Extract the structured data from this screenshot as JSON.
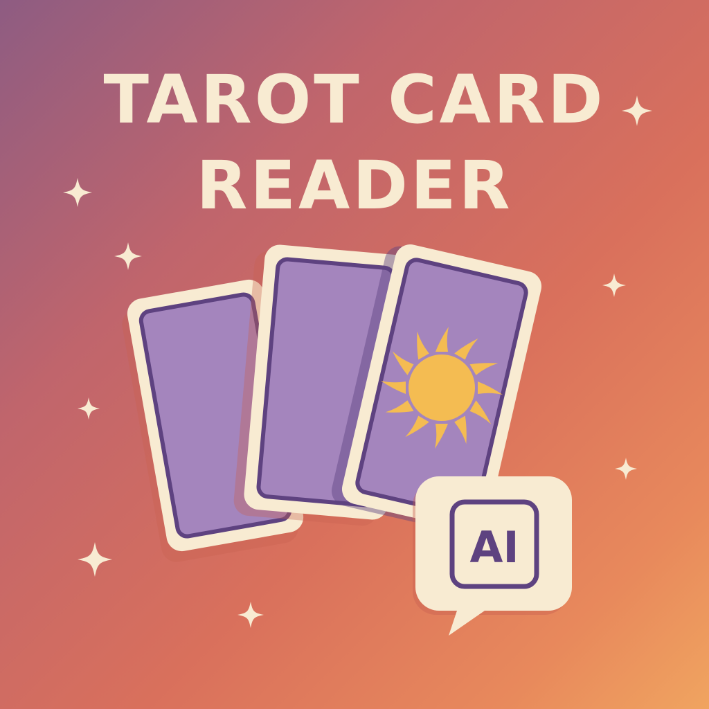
{
  "title": {
    "line1": "TAROT CARD",
    "line2": "READER"
  },
  "badge": {
    "label": "AI",
    "icon": "speech-bubble-icon"
  },
  "cards": [
    {
      "name": "card-back-left",
      "icon": "none"
    },
    {
      "name": "card-back-middle",
      "icon": "none"
    },
    {
      "name": "card-front-sun",
      "icon": "sun-icon"
    }
  ],
  "colors": {
    "background_start": "#8e5c82",
    "background_end": "#f0a460",
    "cream": "#f8ebd2",
    "card_purple": "#a485bd",
    "card_border": "#5e4280",
    "sun": "#f4bc52"
  },
  "decorations": {
    "sparkle_icon": "sparkle-icon"
  }
}
